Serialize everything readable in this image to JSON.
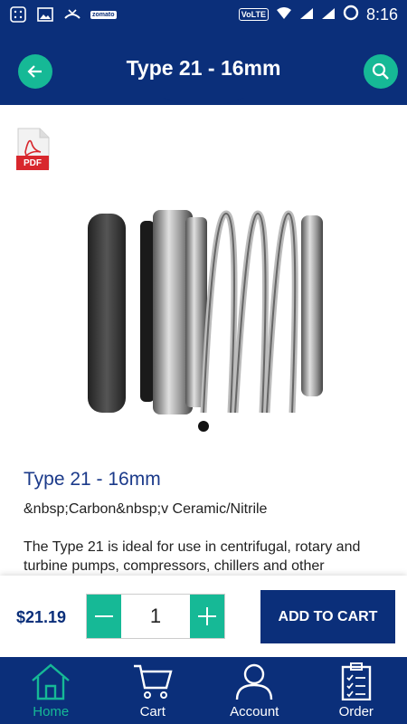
{
  "status_bar": {
    "network": "VoLTE",
    "app_notif": "zomato",
    "time": "8:16"
  },
  "header": {
    "title": "Type 21 - 16mm",
    "back_icon": "arrow-left-icon",
    "search_icon": "search-icon"
  },
  "product": {
    "pdf_label": "PDF",
    "name": "Type 21 - 16mm",
    "spec": "&nbsp;Carbon&nbsp;v Ceramic/Nitrile",
    "description": "The Type 21 is ideal for use in centrifugal, rotary and turbine pumps, compressors, chillers and other"
  },
  "purchase": {
    "price": "$21.19",
    "quantity": "1",
    "add_to_cart_label": "ADD TO CART"
  },
  "nav": {
    "items": [
      {
        "label": "Home",
        "icon": "home-icon",
        "active": true
      },
      {
        "label": "Cart",
        "icon": "cart-icon",
        "active": false
      },
      {
        "label": "Account",
        "icon": "user-icon",
        "active": false
      },
      {
        "label": "Order",
        "icon": "clipboard-icon",
        "active": false
      }
    ]
  },
  "colors": {
    "primary": "#0b2f7a",
    "accent": "#16b996",
    "pdf_red": "#d8272d"
  }
}
